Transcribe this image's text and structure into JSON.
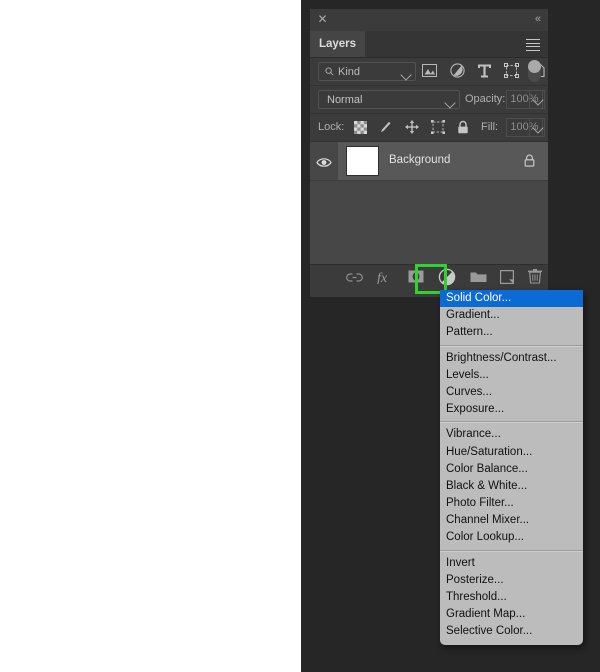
{
  "panel": {
    "close_icon": "close-icon",
    "collapse_icon": "collapse-panel-icon",
    "tab_label": "Layers",
    "menu_icon": "hamburger-menu-icon"
  },
  "filter_row": {
    "kind_label": "Kind",
    "search_icon": "search-icon",
    "icons": [
      "pixel-layer-filter-icon",
      "adjustment-layer-filter-icon",
      "type-layer-filter-icon",
      "shape-layer-filter-icon",
      "smart-object-filter-icon"
    ],
    "toggle_icon": "filter-enable-toggle"
  },
  "blend_row": {
    "blend_mode": "Normal",
    "opacity_label": "Opacity:",
    "opacity_value": "100%"
  },
  "lock_row": {
    "lock_label": "Lock:",
    "icons": [
      "lock-transparent-pixels-icon",
      "lock-image-pixels-icon",
      "lock-position-icon",
      "lock-artboard-nesting-icon",
      "lock-all-icon"
    ],
    "fill_label": "Fill:",
    "fill_value": "100%"
  },
  "layers": [
    {
      "name": "Background",
      "visible_icon": "eye-icon",
      "lock_icon": "lock-icon",
      "thumbnail_color": "#ffffff"
    }
  ],
  "bottom_toolbar": {
    "icons": [
      "link-layers-icon",
      "layer-style-fx-icon",
      "add-layer-mask-icon",
      "new-adjustment-layer-icon",
      "new-group-icon",
      "new-layer-icon",
      "delete-layer-icon"
    ],
    "highlight_color": "#2fd22f",
    "highlighted_icon": "new-adjustment-layer-icon"
  },
  "menu": {
    "selected_item": "Solid Color...",
    "selected_color": "#0c6ad4",
    "groups": [
      [
        "Solid Color...",
        "Gradient...",
        "Pattern..."
      ],
      [
        "Brightness/Contrast...",
        "Levels...",
        "Curves...",
        "Exposure..."
      ],
      [
        "Vibrance...",
        "Hue/Saturation...",
        "Color Balance...",
        "Black & White...",
        "Photo Filter...",
        "Channel Mixer...",
        "Color Lookup..."
      ],
      [
        "Invert",
        "Posterize...",
        "Threshold...",
        "Gradient Map...",
        "Selective Color..."
      ]
    ]
  }
}
